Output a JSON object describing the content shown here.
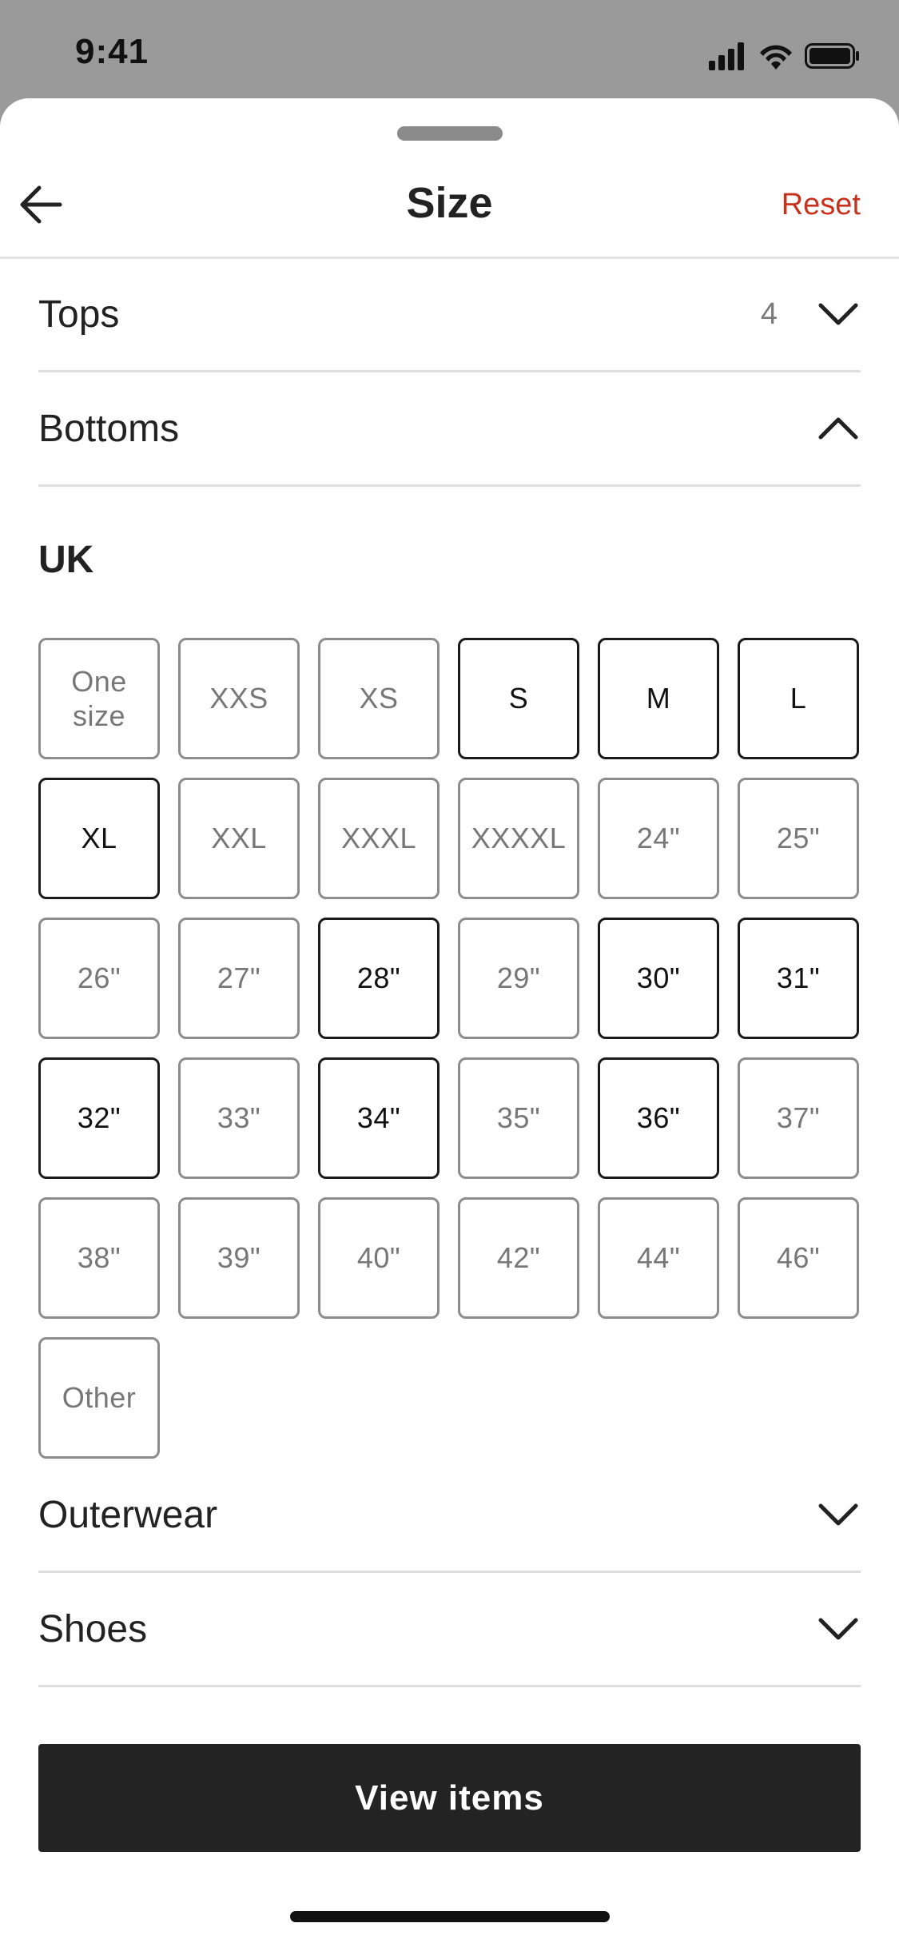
{
  "status_bar": {
    "time": "9:41"
  },
  "sheet": {
    "title": "Size",
    "reset_label": "Reset"
  },
  "categories": {
    "tops": {
      "label": "Tops",
      "count": "4",
      "state": "collapsed"
    },
    "bottoms": {
      "label": "Bottoms",
      "state": "expanded"
    },
    "outerwear": {
      "label": "Outerwear",
      "state": "collapsed"
    },
    "shoes": {
      "label": "Shoes",
      "state": "collapsed"
    }
  },
  "bottoms_region_label": "UK",
  "sizes": [
    {
      "label": "One size",
      "available": false
    },
    {
      "label": "XXS",
      "available": false
    },
    {
      "label": "XS",
      "available": false
    },
    {
      "label": "S",
      "available": true
    },
    {
      "label": "M",
      "available": true
    },
    {
      "label": "L",
      "available": true
    },
    {
      "label": "XL",
      "available": true
    },
    {
      "label": "XXL",
      "available": false
    },
    {
      "label": "XXXL",
      "available": false
    },
    {
      "label": "XXXXL",
      "available": false
    },
    {
      "label": "24\"",
      "available": false
    },
    {
      "label": "25\"",
      "available": false
    },
    {
      "label": "26\"",
      "available": false
    },
    {
      "label": "27\"",
      "available": false
    },
    {
      "label": "28\"",
      "available": true
    },
    {
      "label": "29\"",
      "available": false
    },
    {
      "label": "30\"",
      "available": true
    },
    {
      "label": "31\"",
      "available": true
    },
    {
      "label": "32\"",
      "available": true
    },
    {
      "label": "33\"",
      "available": false
    },
    {
      "label": "34\"",
      "available": true
    },
    {
      "label": "35\"",
      "available": false
    },
    {
      "label": "36\"",
      "available": true
    },
    {
      "label": "37\"",
      "available": false
    },
    {
      "label": "38\"",
      "available": false
    },
    {
      "label": "39\"",
      "available": false
    },
    {
      "label": "40\"",
      "available": false
    },
    {
      "label": "42\"",
      "available": false
    },
    {
      "label": "44\"",
      "available": false
    },
    {
      "label": "46\"",
      "available": false
    },
    {
      "label": "Other",
      "available": false
    }
  ],
  "view_button_label": "View items",
  "colors": {
    "accent_reset": "#c8321d",
    "button_bg": "#232323",
    "available_border": "#1a1a1a",
    "unavailable_border": "#8c8c8c"
  },
  "icons": {
    "back": "arrow-left-icon",
    "expand": "chevron-down-icon",
    "collapse": "chevron-up-icon"
  }
}
